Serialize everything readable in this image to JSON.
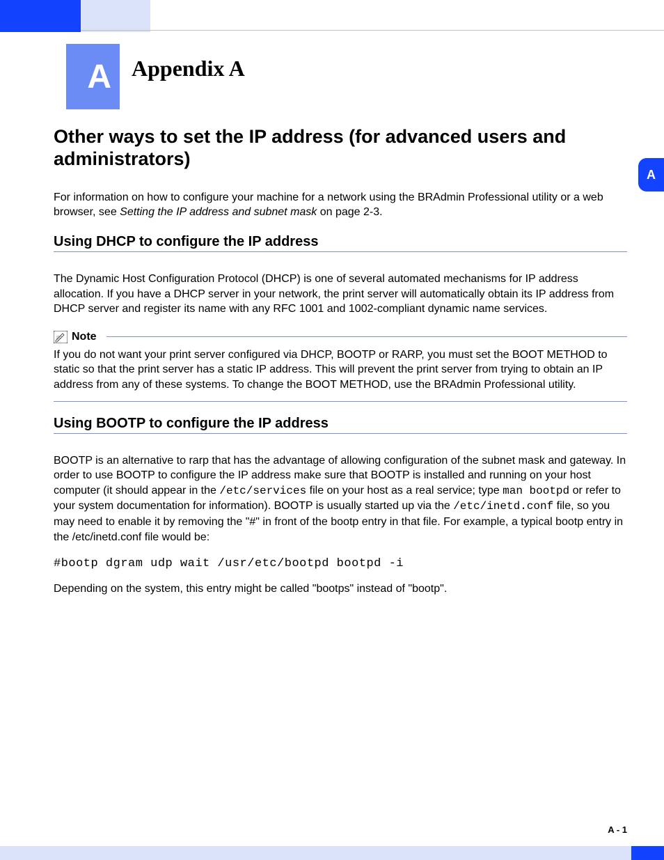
{
  "appendixLetter": "A",
  "appendixTitle": "Appendix A",
  "sideTab": "A",
  "pageNumber": "A - 1",
  "h1": "Other ways to set the IP address (for advanced users and administrators)",
  "intro_pre": "For information on how to configure your machine for a network using the BRAdmin Professional utility or a web browser, see ",
  "intro_link": "Setting the IP address and subnet mask",
  "intro_post": " on page 2-3.",
  "section1": {
    "title": "Using DHCP to configure the IP address",
    "body": "The Dynamic Host Configuration Protocol (DHCP) is one of several automated mechanisms for IP address allocation. If you have a DHCP server in your network, the print server will automatically obtain its IP address from DHCP server and register its name with any RFC 1001 and 1002-compliant dynamic name services."
  },
  "note": {
    "label": "Note",
    "body": "If you do not want your print server configured via DHCP, BOOTP or RARP, you must set the BOOT METHOD to static so that the print server has a static IP address. This will prevent the print server from trying to obtain an IP address from any of these systems. To change the BOOT METHOD, use the BRAdmin Professional utility."
  },
  "section2": {
    "title": "Using BOOTP to configure the IP address",
    "p1a": "BOOTP is an alternative to rarp that has the advantage of allowing configuration of the subnet mask and gateway. In order to use BOOTP to configure the IP address make sure that BOOTP is installed and running on your host computer (it should appear in the ",
    "code1": "/etc/services",
    "p1b": " file on your host as a real service; type ",
    "code2": "man bootpd",
    "p1c": " or refer to your system documentation for information). BOOTP is usually started up via the ",
    "code3": "/etc/inetd.conf",
    "p1d": " file, so you may need to enable it by removing the \"#\" in front of the bootp entry in that file. For example, a typical bootp entry in the /etc/inetd.conf file would be:",
    "codeLine": "#bootp dgram udp wait /usr/etc/bootpd bootpd -i",
    "p2": "Depending on the system, this entry might be called \"bootps\" instead of \"bootp\"."
  }
}
